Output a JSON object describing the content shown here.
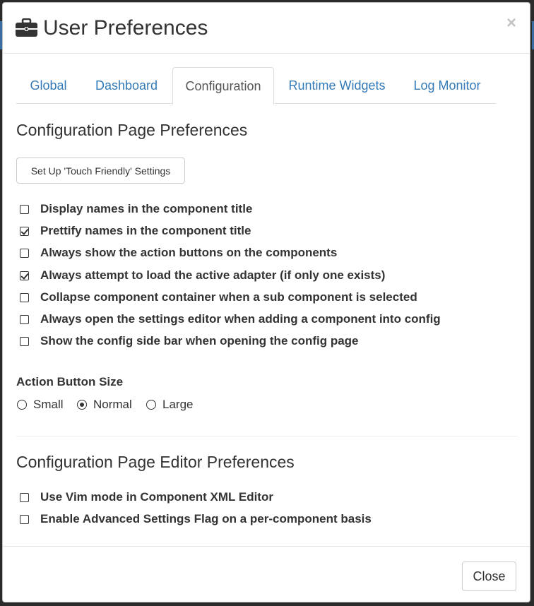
{
  "modal": {
    "title": "User Preferences",
    "header_icon": "briefcase-icon",
    "close_glyph": "×"
  },
  "tabs": [
    {
      "label": "Global",
      "active": false
    },
    {
      "label": "Dashboard",
      "active": false
    },
    {
      "label": "Configuration",
      "active": true
    },
    {
      "label": "Runtime Widgets",
      "active": false
    },
    {
      "label": "Log Monitor",
      "active": false
    }
  ],
  "config_prefs": {
    "heading": "Configuration Page Preferences",
    "touch_button_label": "Set Up 'Touch Friendly' Settings",
    "options": [
      {
        "label": "Display names in the component title",
        "checked": false
      },
      {
        "label": "Prettify names in the component title",
        "checked": true
      },
      {
        "label": "Always show the action buttons on the components",
        "checked": false
      },
      {
        "label": "Always attempt to load the active adapter (if only one exists)",
        "checked": true
      },
      {
        "label": "Collapse component container when a sub component is selected",
        "checked": false
      },
      {
        "label": "Always open the settings editor when adding a component into config",
        "checked": false
      },
      {
        "label": "Show the config side bar when opening the config page",
        "checked": false
      }
    ],
    "action_button_size": {
      "label": "Action Button Size",
      "options": [
        {
          "label": "Small",
          "selected": false
        },
        {
          "label": "Normal",
          "selected": true
        },
        {
          "label": "Large",
          "selected": false
        }
      ]
    }
  },
  "editor_prefs": {
    "heading": "Configuration Page Editor Preferences",
    "options": [
      {
        "label": "Use Vim mode in Component XML Editor",
        "checked": false
      },
      {
        "label": "Enable Advanced Settings Flag on a per-component basis",
        "checked": false
      }
    ]
  },
  "footer": {
    "close_label": "Close"
  },
  "colors": {
    "link": "#337ab7",
    "text": "#333333",
    "border": "#dddddd"
  }
}
